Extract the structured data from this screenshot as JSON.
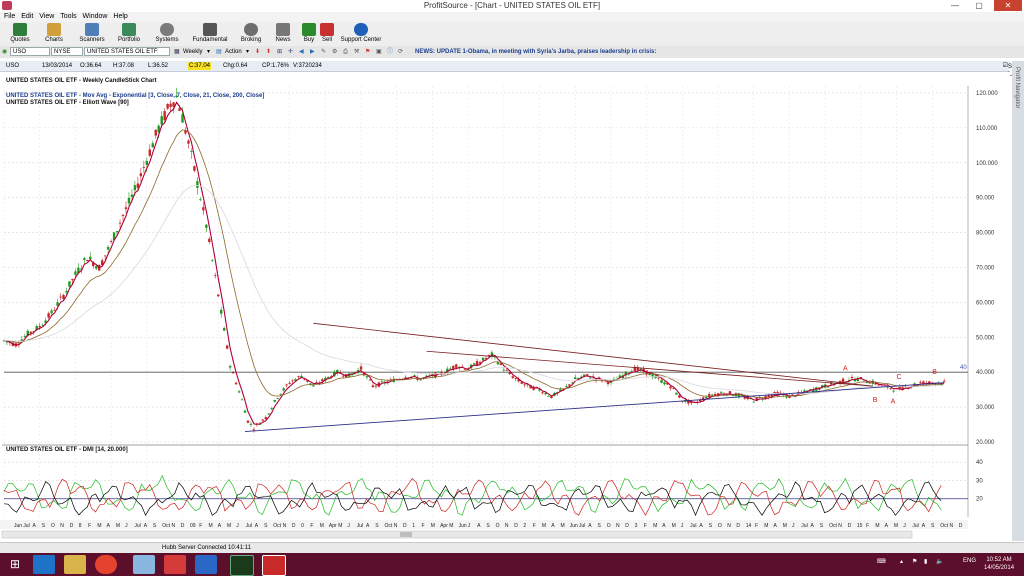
{
  "window": {
    "title": "ProfitSource - [Chart - UNITED STATES OIL ETF]",
    "minimize": "—",
    "maximize": "▢",
    "close": "✕"
  },
  "menu": [
    "File",
    "Edit",
    "View",
    "Tools",
    "Window",
    "Help"
  ],
  "toolbar": [
    {
      "label": "Quotes",
      "icon": "quotes-icon",
      "color": "#2f7d3a"
    },
    {
      "label": "Charts",
      "icon": "charts-icon",
      "color": "#d2a03a"
    },
    {
      "label": "Scanners",
      "icon": "scanners-icon",
      "color": "#4f7fb8"
    },
    {
      "label": "Portfolio",
      "icon": "portfolio-icon",
      "color": "#3a8a5a"
    },
    {
      "label": "Systems",
      "icon": "systems-icon",
      "color": "#7b7b7b"
    },
    {
      "label": "Fundamental",
      "icon": "fundamental-icon",
      "color": "#555555"
    },
    {
      "label": "Broking",
      "icon": "broking-icon",
      "color": "#6e6e6e"
    },
    {
      "label": "News",
      "icon": "news-icon",
      "color": "#777777"
    },
    {
      "label": "Buy",
      "icon": "buy-icon",
      "color": "#2b8a2b"
    },
    {
      "label": "Sell",
      "icon": "sell-icon",
      "color": "#c73030"
    },
    {
      "label": "Support Center",
      "icon": "support-icon",
      "color": "#1f5fb8"
    }
  ],
  "symbolbar": {
    "symbol": "USO",
    "exchange": "NYSE",
    "name": "UNITED STATES OIL ETF",
    "period": "Weekly",
    "action": "Action",
    "news": "NEWS: UPDATE 1-Obama, in meeting with Syria's Jarba, praises leadership in crisis:"
  },
  "quote": {
    "symbol": "USO",
    "date": "13/03/2014",
    "open": "O:36.64",
    "high": "H:37.08",
    "low": "L:36.52",
    "close": "C:37.04",
    "change": "Chg:0.64",
    "changepct": "CP:1.76%",
    "volume": "V:3720234",
    "show_last": "Show Last"
  },
  "side_tab": "Profit Navigator",
  "status": "Hubb Server Connected 10:41:11",
  "clock": {
    "time": "10:52 AM",
    "date": "14/05/2014"
  },
  "tray": {
    "lang": "ENG"
  },
  "chart_data": {
    "type": "candlestick",
    "title": "UNITED STATES OIL ETF - Weekly CandleStick Chart",
    "indicator_lines": [
      "UNITED STATES OIL ETF - Mov Avg - Exponential [3, Close, 7, Close, 21, Close, 200, Close]",
      "UNITED STATES OIL ETF - Elliott Wave [90]"
    ],
    "ylim": [
      20,
      122
    ],
    "yticks": [
      "120.000",
      "110.000",
      "100.000",
      "90.000",
      "80.000",
      "70.000",
      "60.000",
      "50.000",
      "40.000",
      "30.000",
      "20.000"
    ],
    "ytick_values": [
      120,
      110,
      100,
      90,
      80,
      70,
      60,
      50,
      40,
      30,
      20
    ],
    "horizontal_line": 40,
    "horizontal_line_label": "40",
    "price_path": [
      [
        0,
        49
      ],
      [
        2,
        48
      ],
      [
        4,
        51
      ],
      [
        6,
        53
      ],
      [
        8,
        57
      ],
      [
        10,
        62
      ],
      [
        12,
        68
      ],
      [
        14,
        73
      ],
      [
        16,
        70
      ],
      [
        18,
        77
      ],
      [
        20,
        85
      ],
      [
        22,
        92
      ],
      [
        24,
        101
      ],
      [
        26,
        110
      ],
      [
        28,
        117
      ],
      [
        29,
        119
      ],
      [
        30,
        113
      ],
      [
        32,
        98
      ],
      [
        34,
        82
      ],
      [
        36,
        62
      ],
      [
        38,
        42
      ],
      [
        40,
        32
      ],
      [
        41,
        26
      ],
      [
        42,
        24
      ],
      [
        44,
        27
      ],
      [
        46,
        33
      ],
      [
        48,
        37
      ],
      [
        50,
        39
      ],
      [
        52,
        36
      ],
      [
        54,
        38
      ],
      [
        56,
        40
      ],
      [
        58,
        39
      ],
      [
        60,
        41
      ],
      [
        62,
        36
      ],
      [
        64,
        37
      ],
      [
        66,
        38
      ],
      [
        68,
        39
      ],
      [
        70,
        38
      ],
      [
        72,
        39
      ],
      [
        74,
        40
      ],
      [
        76,
        42
      ],
      [
        78,
        41
      ],
      [
        80,
        43
      ],
      [
        82,
        45
      ],
      [
        84,
        41
      ],
      [
        86,
        38
      ],
      [
        88,
        36
      ],
      [
        90,
        35
      ],
      [
        92,
        33
      ],
      [
        94,
        35
      ],
      [
        96,
        38
      ],
      [
        98,
        39
      ],
      [
        100,
        38
      ],
      [
        102,
        37
      ],
      [
        104,
        39
      ],
      [
        106,
        41
      ],
      [
        108,
        40
      ],
      [
        110,
        38
      ],
      [
        112,
        36
      ],
      [
        114,
        32
      ],
      [
        116,
        31
      ],
      [
        118,
        33
      ],
      [
        120,
        34
      ],
      [
        122,
        34
      ],
      [
        124,
        33
      ],
      [
        126,
        32
      ],
      [
        128,
        33
      ],
      [
        130,
        34
      ],
      [
        132,
        33
      ],
      [
        134,
        34
      ],
      [
        136,
        35
      ],
      [
        138,
        36
      ],
      [
        140,
        37
      ],
      [
        142,
        38
      ],
      [
        144,
        38
      ],
      [
        146,
        37
      ],
      [
        148,
        36
      ],
      [
        150,
        35
      ],
      [
        152,
        36
      ],
      [
        154,
        37
      ],
      [
        156,
        37
      ],
      [
        158,
        37
      ]
    ],
    "wave_labels": [
      {
        "text": "A",
        "x": 141,
        "y": 40.5
      },
      {
        "text": "C",
        "x": 150,
        "y": 38
      },
      {
        "text": "B",
        "x": 156,
        "y": 39.5
      },
      {
        "text": "B",
        "x": 146,
        "y": 31.5
      },
      {
        "text": "A",
        "x": 149,
        "y": 31
      }
    ],
    "dmi_title": "UNITED STATES OIL ETF - DMI [14, 20.000]",
    "dmi_ylim": [
      10,
      45
    ],
    "dmi_yticks": [
      "40",
      "30",
      "20"
    ],
    "dmi_ytick_values": [
      40,
      30,
      20
    ],
    "x_labels": [
      "Jun",
      "Jul",
      "A",
      "S",
      "O",
      "N",
      "D",
      "8",
      "F",
      "M",
      "A",
      "M",
      "J",
      "Jul",
      "A",
      "S",
      "Oct",
      "N",
      "D",
      "09",
      "F",
      "M",
      "A",
      "M",
      "J",
      "Jul",
      "A",
      "S",
      "Oct",
      "N",
      "D",
      "0",
      "F",
      "M",
      "Apr",
      "M",
      "J",
      "Jul",
      "A",
      "S",
      "Oct",
      "N",
      "D",
      "1",
      "F",
      "M",
      "Apr",
      "M",
      "Jun",
      "J",
      "A",
      "S",
      "O",
      "N",
      "D",
      "2",
      "F",
      "M",
      "A",
      "M",
      "Jun",
      "Jul",
      "A",
      "S",
      "O",
      "N",
      "D",
      "3",
      "F",
      "M",
      "A",
      "M",
      "J",
      "Jul",
      "A",
      "S",
      "O",
      "N",
      "D",
      "14",
      "F",
      "M",
      "A",
      "M",
      "J",
      "Jul",
      "A",
      "S",
      "Oct",
      "N",
      "D",
      "15",
      "F",
      "M",
      "A",
      "M",
      "J",
      "Jul",
      "A",
      "S",
      "Oct",
      "N",
      "D"
    ],
    "colors": {
      "bull": "#1f9a1f",
      "bear": "#c62828",
      "ema3": "#b0003a",
      "ema21": "#8a6a2a",
      "trendline": "#2c2c8c",
      "resistance": "#7a1f1f",
      "dmi_plus": "#22bb22",
      "dmi_minus": "#cc2222",
      "adx": "#000000"
    }
  }
}
